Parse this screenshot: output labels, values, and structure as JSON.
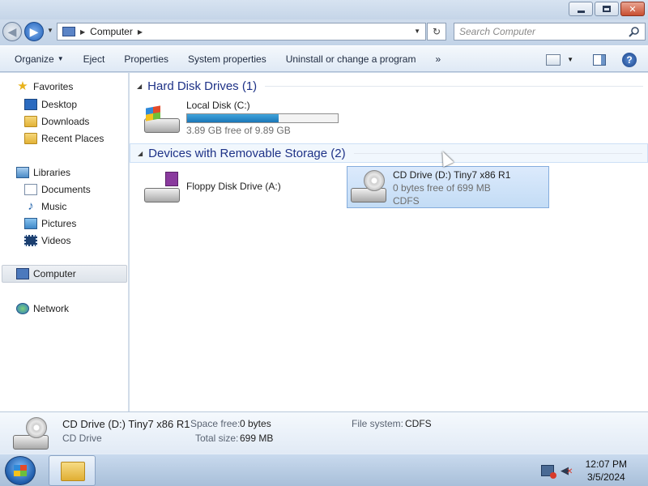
{
  "window": {
    "minimize_symbol": "",
    "maximize_symbol": "",
    "close_symbol": "✕"
  },
  "navigation": {
    "back_symbol": "◀",
    "forward_symbol": "▶",
    "breadcrumb": [
      "Computer"
    ],
    "refresh_symbol": "↻",
    "search_placeholder": "Search Computer"
  },
  "toolbar": {
    "items": [
      "Organize",
      "Eject",
      "Properties",
      "System properties",
      "Uninstall or change a program"
    ],
    "more_symbol": "»",
    "help_symbol": "?"
  },
  "sidebar": {
    "favorites": {
      "label": "Favorites",
      "items": [
        "Desktop",
        "Downloads",
        "Recent Places"
      ]
    },
    "libraries": {
      "label": "Libraries",
      "items": [
        "Documents",
        "Music",
        "Pictures",
        "Videos"
      ]
    },
    "computer": "Computer",
    "network": "Network"
  },
  "groups": [
    {
      "title": "Hard Disk Drives (1)",
      "drives": [
        {
          "name": "Local Disk (C:)",
          "free": "3.89 GB free of 9.89 GB",
          "used_fraction": 0.607,
          "icon": "hard-disk-icon"
        }
      ]
    },
    {
      "title": "Devices with Removable Storage (2)",
      "drives": [
        {
          "name": "Floppy Disk Drive (A:)",
          "icon": "floppy-drive-icon"
        },
        {
          "name": "CD Drive (D:) Tiny7 x86 R1",
          "free": "0 bytes free of 699 MB",
          "fs": "CDFS",
          "icon": "cd-drive-icon",
          "selected": true
        }
      ]
    }
  ],
  "details": {
    "name": "CD Drive (D:) Tiny7 x86 R1",
    "type": "CD Drive",
    "space_free_label": "Space free:",
    "space_free": "0 bytes",
    "total_size_label": "Total size:",
    "total_size": "699 MB",
    "fs_label": "File system:",
    "fs": "CDFS"
  },
  "taskbar": {
    "time": "12:07 PM",
    "date": "3/5/2024"
  }
}
